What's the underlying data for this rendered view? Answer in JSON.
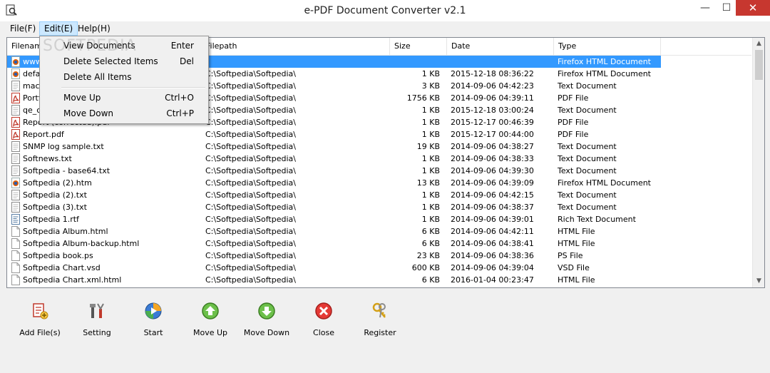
{
  "window": {
    "title": "e-PDF Document Converter v2.1"
  },
  "menu": {
    "file": "File(F)",
    "edit": "Edit(E)",
    "help": "Help(H)"
  },
  "edit_menu": [
    {
      "label": "View Documents",
      "shortcut": "Enter"
    },
    {
      "label": "Delete Selected Items",
      "shortcut": "Del"
    },
    {
      "label": "Delete All Items",
      "shortcut": ""
    },
    {
      "label": "Move Up",
      "shortcut": "Ctrl+O"
    },
    {
      "label": "Move Down",
      "shortcut": "Ctrl+P"
    }
  ],
  "watermark": "SOFTPEDIA",
  "table": {
    "columns": [
      "Filename",
      "Filepath",
      "Size",
      "Date",
      "Type"
    ],
    "rows": [
      {
        "icon": "firefox",
        "name": "www...",
        "path": "",
        "size": "",
        "date": "",
        "type": "Firefox HTML Document",
        "selected": true
      },
      {
        "icon": "firefox",
        "name": "defa...",
        "path": "C:\\Softpedia\\Softpedia\\",
        "size": "1 KB",
        "date": "2015-12-18 08:36:22",
        "type": "Firefox HTML Document"
      },
      {
        "icon": "text",
        "name": "mac...",
        "path": "C:\\Softpedia\\Softpedia\\",
        "size": "3 KB",
        "date": "2014-09-06 04:42:23",
        "type": "Text Document"
      },
      {
        "icon": "pdf",
        "name": "Portf...",
        "path": "C:\\Softpedia\\Softpedia\\",
        "size": "1756 KB",
        "date": "2014-09-06 04:39:11",
        "type": "PDF File"
      },
      {
        "icon": "text",
        "name": "qe_c...",
        "path": "C:\\Softpedia\\Softpedia\\",
        "size": "1 KB",
        "date": "2015-12-18 03:00:24",
        "type": "Text Document"
      },
      {
        "icon": "pdf",
        "name": "Report (corrected).pdf",
        "path": "C:\\Softpedia\\Softpedia\\",
        "size": "1 KB",
        "date": "2015-12-17 00:46:39",
        "type": "PDF File"
      },
      {
        "icon": "pdf",
        "name": "Report.pdf",
        "path": "C:\\Softpedia\\Softpedia\\",
        "size": "1 KB",
        "date": "2015-12-17 00:44:00",
        "type": "PDF File"
      },
      {
        "icon": "text",
        "name": "SNMP log sample.txt",
        "path": "C:\\Softpedia\\Softpedia\\",
        "size": "19 KB",
        "date": "2014-09-06 04:38:27",
        "type": "Text Document"
      },
      {
        "icon": "text",
        "name": "Softnews.txt",
        "path": "C:\\Softpedia\\Softpedia\\",
        "size": "1 KB",
        "date": "2014-09-06 04:38:33",
        "type": "Text Document"
      },
      {
        "icon": "text",
        "name": "Softpedia - base64.txt",
        "path": "C:\\Softpedia\\Softpedia\\",
        "size": "1 KB",
        "date": "2014-09-06 04:39:30",
        "type": "Text Document"
      },
      {
        "icon": "firefox",
        "name": "Softpedia (2).htm",
        "path": "C:\\Softpedia\\Softpedia\\",
        "size": "13 KB",
        "date": "2014-09-06 04:39:09",
        "type": "Firefox HTML Document"
      },
      {
        "icon": "text",
        "name": "Softpedia (2).txt",
        "path": "C:\\Softpedia\\Softpedia\\",
        "size": "1 KB",
        "date": "2014-09-06 04:42:15",
        "type": "Text Document"
      },
      {
        "icon": "text",
        "name": "Softpedia (3).txt",
        "path": "C:\\Softpedia\\Softpedia\\",
        "size": "1 KB",
        "date": "2014-09-06 04:38:37",
        "type": "Text Document"
      },
      {
        "icon": "rtf",
        "name": "Softpedia 1.rtf",
        "path": "C:\\Softpedia\\Softpedia\\",
        "size": "1 KB",
        "date": "2014-09-06 04:39:01",
        "type": "Rich Text Document"
      },
      {
        "icon": "blank",
        "name": "Softpedia Album.html",
        "path": "C:\\Softpedia\\Softpedia\\",
        "size": "6 KB",
        "date": "2014-09-06 04:42:11",
        "type": "HTML File"
      },
      {
        "icon": "blank",
        "name": "Softpedia Album-backup.html",
        "path": "C:\\Softpedia\\Softpedia\\",
        "size": "6 KB",
        "date": "2014-09-06 04:38:41",
        "type": "HTML File"
      },
      {
        "icon": "blank",
        "name": "Softpedia book.ps",
        "path": "C:\\Softpedia\\Softpedia\\",
        "size": "23 KB",
        "date": "2014-09-06 04:38:36",
        "type": "PS File"
      },
      {
        "icon": "blank",
        "name": "Softpedia Chart.vsd",
        "path": "C:\\Softpedia\\Softpedia\\",
        "size": "600 KB",
        "date": "2014-09-06 04:39:04",
        "type": "VSD File"
      },
      {
        "icon": "blank",
        "name": "Softpedia Chart.xml.html",
        "path": "C:\\Softpedia\\Softpedia\\",
        "size": "6 KB",
        "date": "2016-01-04 00:23:47",
        "type": "HTML File"
      }
    ]
  },
  "toolbar": [
    {
      "id": "add-files",
      "label": "Add File(s)",
      "icon": "add-file-icon"
    },
    {
      "id": "setting",
      "label": "Setting",
      "icon": "tools-icon"
    },
    {
      "id": "start",
      "label": "Start",
      "icon": "start-icon"
    },
    {
      "id": "move-up",
      "label": "Move Up",
      "icon": "arrow-up-icon"
    },
    {
      "id": "move-down",
      "label": "Move Down",
      "icon": "arrow-down-icon"
    },
    {
      "id": "close",
      "label": "Close",
      "icon": "close-icon"
    },
    {
      "id": "register",
      "label": "Register",
      "icon": "keys-icon"
    }
  ],
  "colors": {
    "selection": "#3399ff",
    "menu_highlight": "#cce8ff",
    "close_button": "#c7372f"
  }
}
